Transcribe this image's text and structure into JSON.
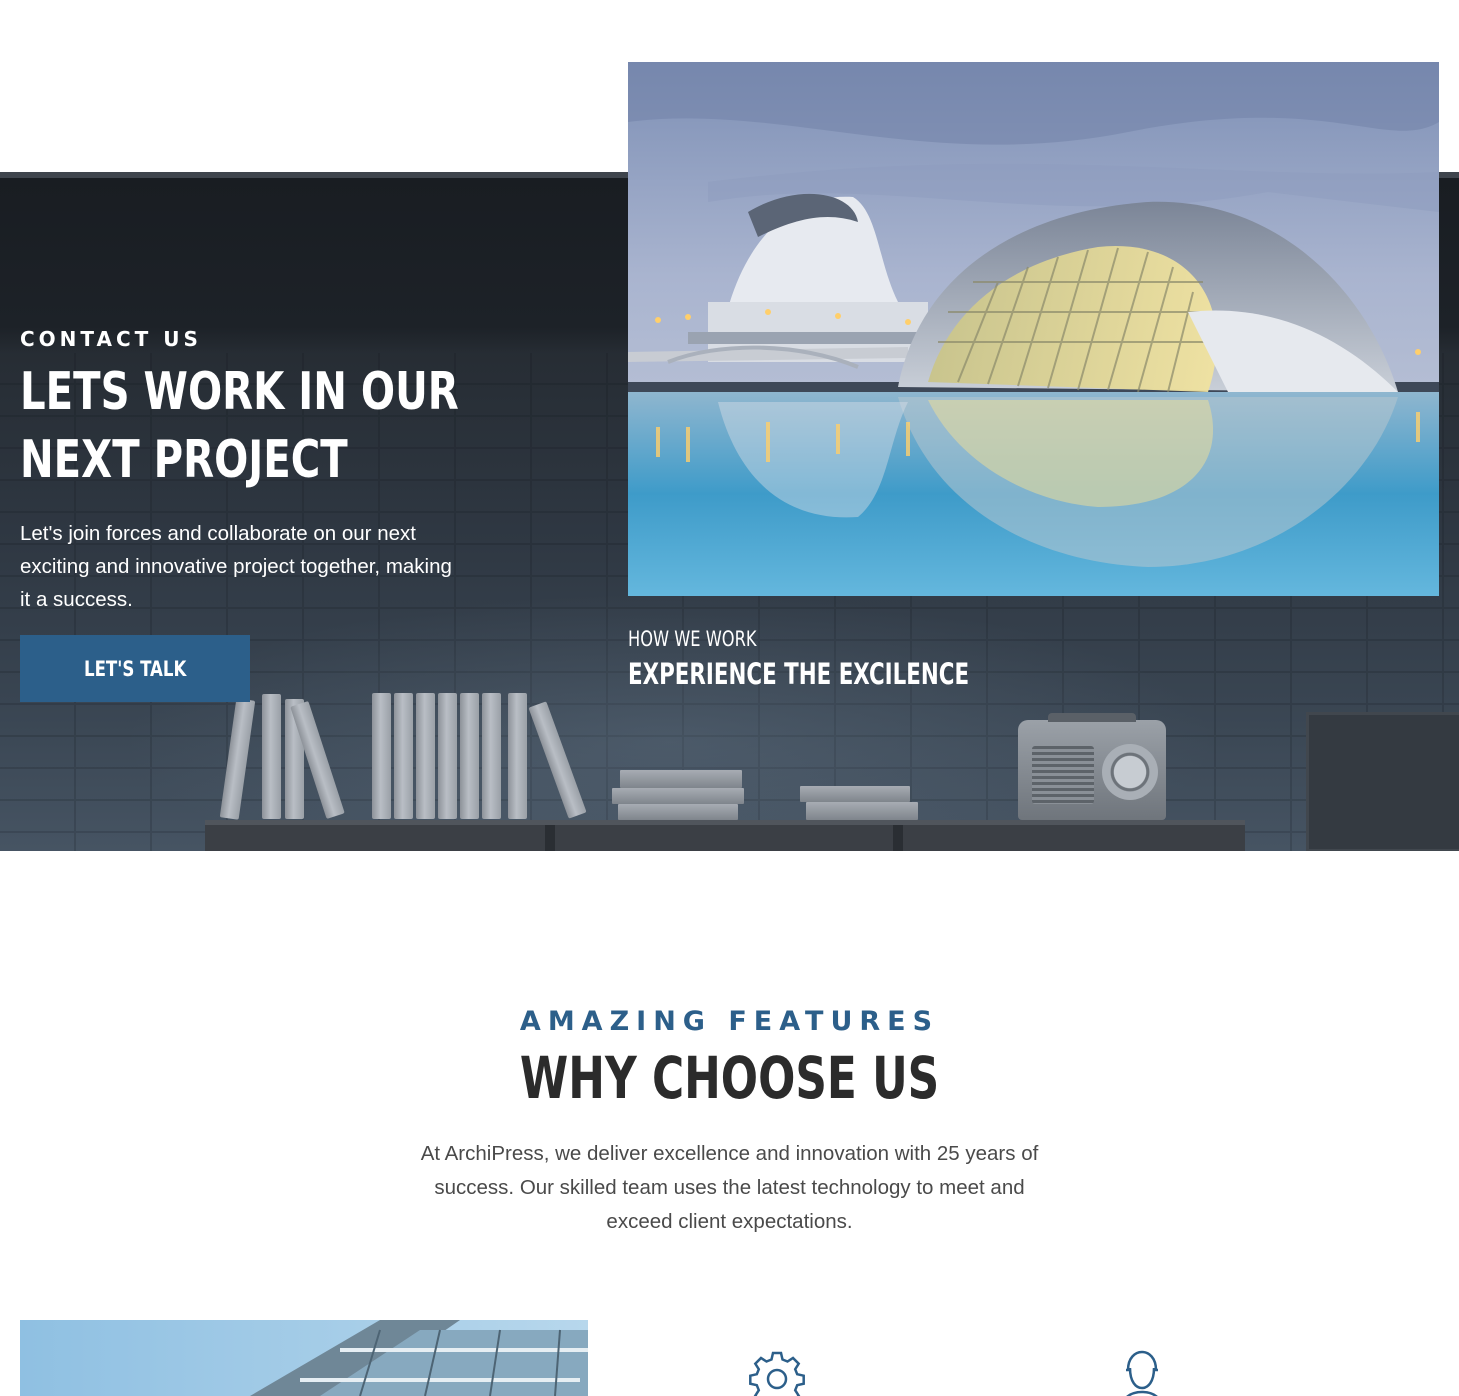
{
  "contact": {
    "label": "CONTACT US",
    "title_line1": "LETS WORK IN OUR",
    "title_line2": "NEXT PROJECT",
    "text": "Let's join forces and collaborate on our next exciting and innovative project together, making it a success.",
    "button_label": "LET'S TALK"
  },
  "how_we_work": {
    "label": "HOW WE WORK",
    "title": "EXPERIENCE THE EXCILENCE"
  },
  "features": {
    "kicker": "AMAZING FEATURES",
    "title": "WHY CHOOSE US",
    "text": "At ArchiPress, we deliver excellence and innovation with 25 years of success. Our skilled team uses the latest technology to meet and exceed client expectations.",
    "icons": [
      "gear-icon",
      "user-icon"
    ]
  },
  "colors": {
    "accent": "#2c5f8a",
    "dark_band": "#262c33",
    "heading_dark": "#2b2b2b"
  }
}
